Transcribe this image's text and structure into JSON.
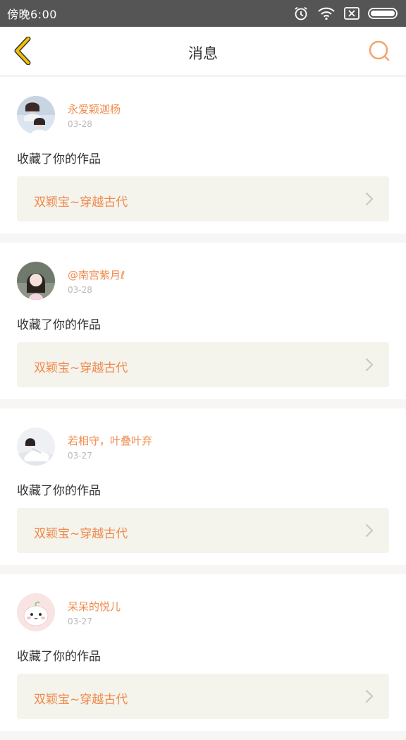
{
  "status_bar": {
    "time": "傍晚6:00",
    "icons": [
      "alarm-icon",
      "wifi-icon",
      "sim-icon",
      "battery-icon"
    ]
  },
  "header": {
    "title": "消息",
    "back_icon": "chevron-left-icon",
    "search_icon": "search-icon"
  },
  "colors": {
    "accent": "#f08a4b",
    "back_icon": "#f2c200",
    "status_bar": "#555555",
    "card_link_bg": "#f4f3ec"
  },
  "messages": [
    {
      "username": "永爱颖迦杨",
      "date": "03-28",
      "action": "收藏了你的作品",
      "work_title": "双颖宝~穿越古代"
    },
    {
      "username": "@南宫紫月ℓ",
      "date": "03-28",
      "action": "收藏了你的作品",
      "work_title": "双颖宝~穿越古代"
    },
    {
      "username": "若相守，叶叠叶弃",
      "date": "03-27",
      "action": "收藏了你的作品",
      "work_title": "双颖宝~穿越古代"
    },
    {
      "username": "呆呆的悦儿",
      "date": "03-27",
      "action": "收藏了你的作品",
      "work_title": "双颖宝~穿越古代"
    }
  ]
}
